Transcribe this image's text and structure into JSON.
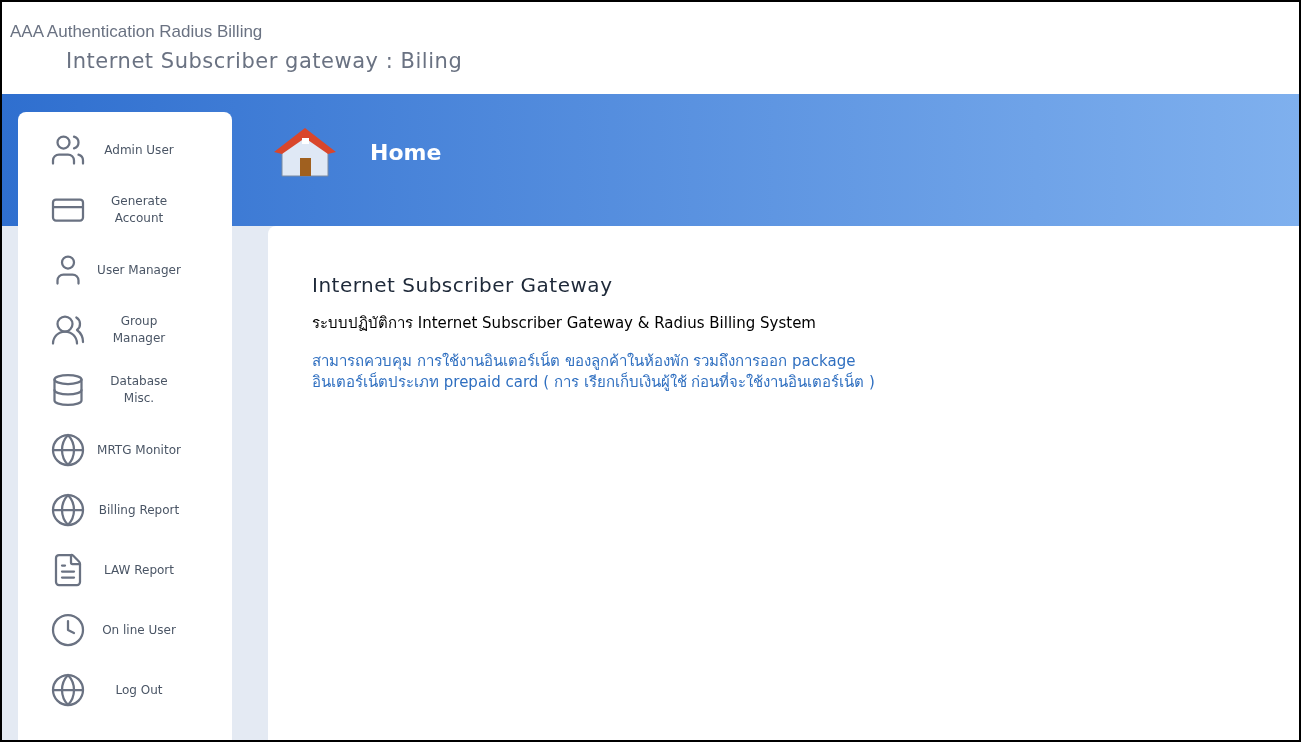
{
  "header": {
    "brand": "AAA Authentication Radius Billing",
    "subtitle": "Internet Subscriber gateway : Biling"
  },
  "sidebar": {
    "items": [
      {
        "label": "Admin User",
        "kind": "users"
      },
      {
        "label": "Generate Account",
        "kind": "account"
      },
      {
        "label": "User Manager",
        "kind": "user"
      },
      {
        "label": "Group Manager",
        "kind": "group"
      },
      {
        "label": "Database Misc.",
        "kind": "database"
      },
      {
        "label": "MRTG Monitor",
        "kind": "globe"
      },
      {
        "label": "Billing Report",
        "kind": "globe"
      },
      {
        "label": "LAW Report",
        "kind": "report"
      },
      {
        "label": "On line User",
        "kind": "online"
      },
      {
        "label": "Log Out",
        "kind": "globe"
      }
    ]
  },
  "page": {
    "title": "Home"
  },
  "content": {
    "heading": "Internet Subscriber Gateway",
    "subheading": "ระบบปฏิบัติการ Internet Subscriber Gateway & Radius Billing System",
    "description": [
      "สามารถควบคุม การใช้งานอินเตอร์เน็ต ของลูกค้าในห้องพัก รวมถึงการออก package",
      "อินเตอร์เน็ตประเภท prepaid card ( การ เรียกเก็บเงินผู้ใช้ ก่อนที่จะใช้งานอินเตอร์เน็ต )"
    ]
  }
}
